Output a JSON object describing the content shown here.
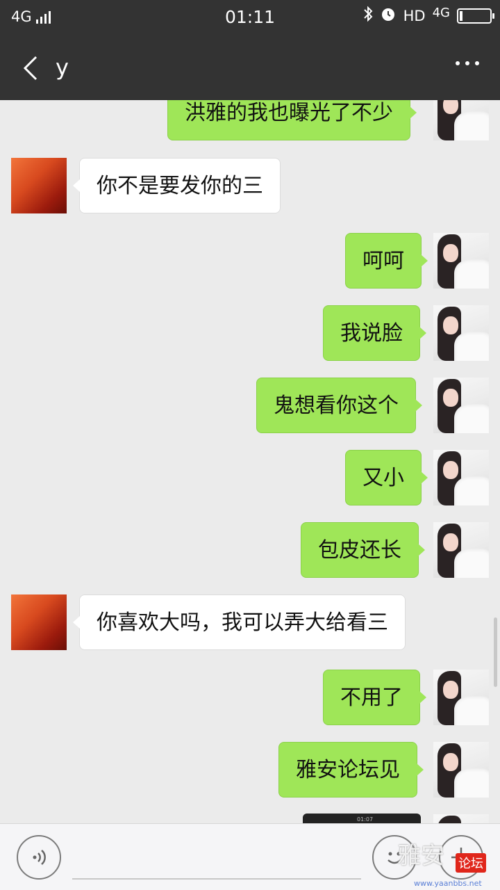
{
  "status_bar": {
    "network_left": "4G",
    "time": "01:11",
    "hd": "HD",
    "network_right": "4G"
  },
  "header": {
    "back_icon": "chevron-left-icon",
    "title": "y",
    "more_icon": "more-dots-icon"
  },
  "messages": [
    {
      "side": "me",
      "text": "洪雅的我也曝光了不少"
    },
    {
      "side": "other",
      "text": "你不是要发你的三"
    },
    {
      "side": "me",
      "text": "呵呵"
    },
    {
      "side": "me",
      "text": "我说脸"
    },
    {
      "side": "me",
      "text": "鬼想看你这个"
    },
    {
      "side": "me",
      "text": "又小"
    },
    {
      "side": "me",
      "text": "包皮还长"
    },
    {
      "side": "other",
      "text": "你喜欢大吗，我可以弄大给看三"
    },
    {
      "side": "me",
      "text": "不用了"
    },
    {
      "side": "me",
      "text": "雅安论坛见"
    }
  ],
  "image_message": {
    "time": "01:07"
  },
  "input_bar": {
    "voice_icon": "voice-icon",
    "emoji_icon": "emoji-icon",
    "plus_icon": "plus-icon"
  },
  "watermark": {
    "text": "雅安",
    "badge": "论坛",
    "url": "www.yaanbbs.net"
  },
  "colors": {
    "bar": "#333333",
    "background": "#ebebeb",
    "my_bubble": "#9fe658",
    "other_bubble": "#ffffff"
  }
}
